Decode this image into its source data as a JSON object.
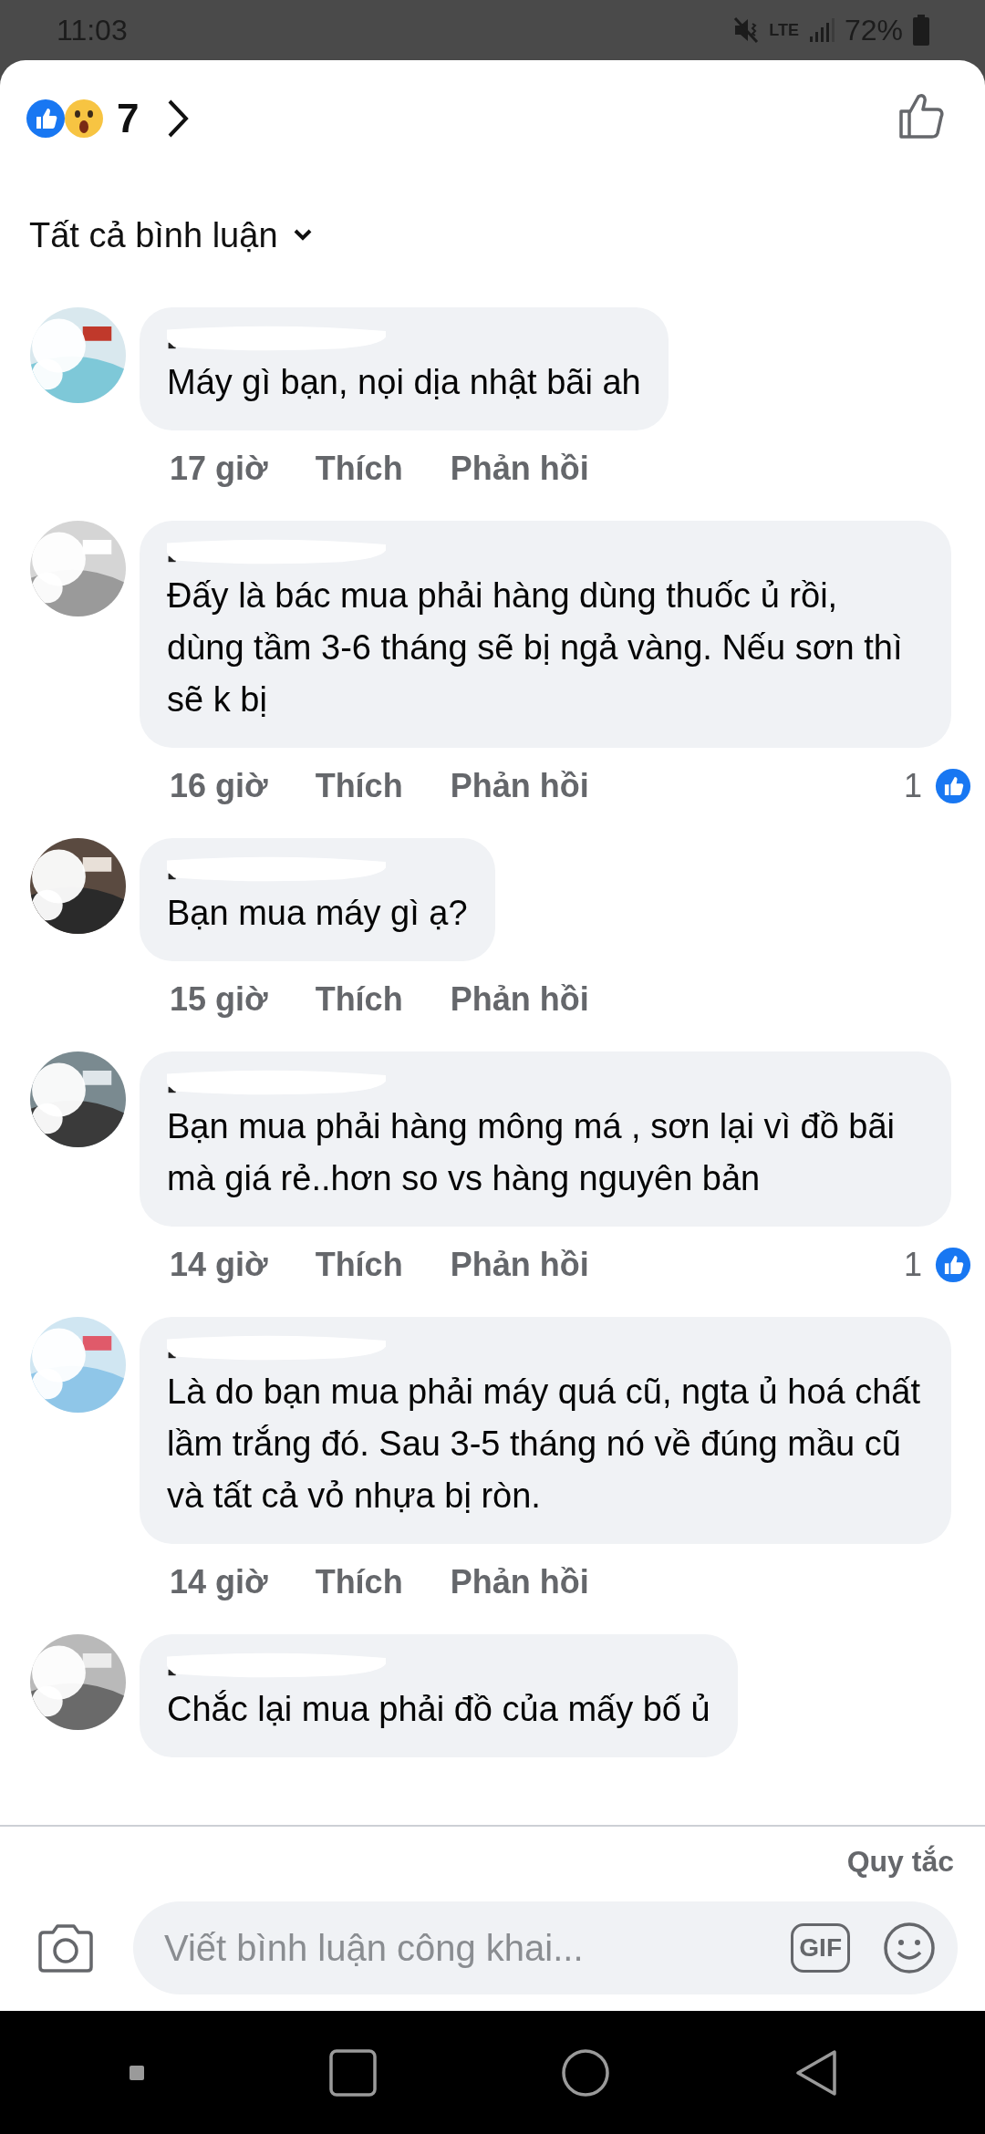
{
  "status_bar": {
    "time": "11:03",
    "network": "LTE",
    "battery": "72%"
  },
  "reactions": {
    "count": "7"
  },
  "filter": {
    "label": "Tất cả bình luận"
  },
  "comments": [
    {
      "text": "Máy gì bạn, nọi dịa nhật bãi ah",
      "time": "17 giờ",
      "like_label": "Thích",
      "reply_label": "Phản hồi"
    },
    {
      "text": "Đấy là bác mua phải hàng dùng thuốc ủ rồi, dùng tầm 3-6 tháng sẽ bị ngả vàng. Nếu sơn thì sẽ k bị",
      "time": "16 giờ",
      "like_label": "Thích",
      "reply_label": "Phản hồi",
      "likes": "1"
    },
    {
      "text": "Bạn mua máy gì ạ?",
      "time": "15 giờ",
      "like_label": "Thích",
      "reply_label": "Phản hồi"
    },
    {
      "text": "Bạn mua phải hàng mông má , sơn lại vì đồ bãi mà giá rẻ..hơn so vs hàng nguyên bản",
      "time": "14 giờ",
      "like_label": "Thích",
      "reply_label": "Phản hồi",
      "likes": "1"
    },
    {
      "text": "Là do bạn mua phải máy quá cũ, ngta ủ hoá chất lầm trắng đó. Sau 3-5 tháng nó về đúng mầu cũ và tất cả vỏ nhựa bị ròn.",
      "time": "14 giờ",
      "like_label": "Thích",
      "reply_label": "Phản hồi"
    },
    {
      "text": "Chắc lại mua phải đồ của mấy bố ủ"
    }
  ],
  "footer": {
    "rules": "Quy tắc",
    "composer": {
      "placeholder": "Viết bình luận công khai..."
    },
    "gif_label": "GIF"
  }
}
